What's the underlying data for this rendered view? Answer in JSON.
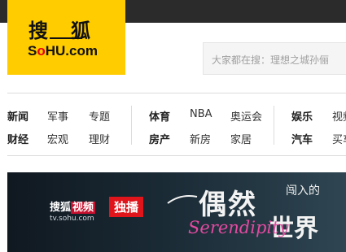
{
  "logo": {
    "cn": "搜狐",
    "en_pre": "S",
    "en_o": "o",
    "en_post": "HU.com"
  },
  "search": {
    "placeholder": "大家都在搜：理想之城孙俪"
  },
  "nav": {
    "row1": [
      "新闻",
      "军事",
      "专题",
      "体育",
      "NBA",
      "奥运会",
      "娱乐",
      "视频"
    ],
    "row2": [
      "财经",
      "宏观",
      "理财",
      "房产",
      "新房",
      "家居",
      "汽车",
      "买车"
    ]
  },
  "banner": {
    "brand": "搜狐",
    "brand_video": "视频",
    "url": "tv.sohu.com",
    "badge": "独播",
    "title_big": "偶然",
    "title_small": "闯入的",
    "title_big2": "世界",
    "title_en": "Serendipity"
  },
  "colors": {
    "logo_bg": "#ffcc00",
    "topbar": "#2b2b2b",
    "badge": "#e0151b",
    "accent_pink": "#e34aa0"
  }
}
